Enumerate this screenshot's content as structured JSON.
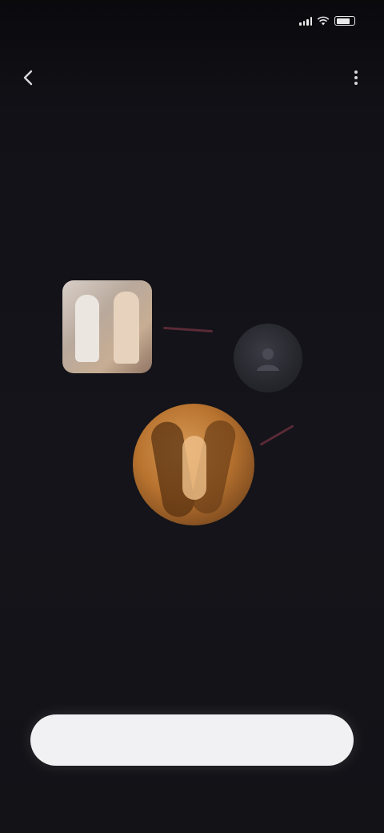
{
  "status_bar": {
    "time": "",
    "icons": [
      "signal-icon",
      "wifi-icon",
      "battery-icon"
    ]
  },
  "nav": {
    "back_icon": "chevron-left-icon",
    "title": "",
    "menu_icon": "more-icon"
  },
  "content": {
    "headline": "",
    "description": ""
  },
  "diagram": {
    "photo_label": "",
    "small_avatar_label": "",
    "main_label": "",
    "connector_color": "#5a2a36"
  },
  "cta": {
    "label": ""
  },
  "colors": {
    "background": "#121217",
    "button": "#f1f1f3",
    "accent": "#5a2a36"
  }
}
